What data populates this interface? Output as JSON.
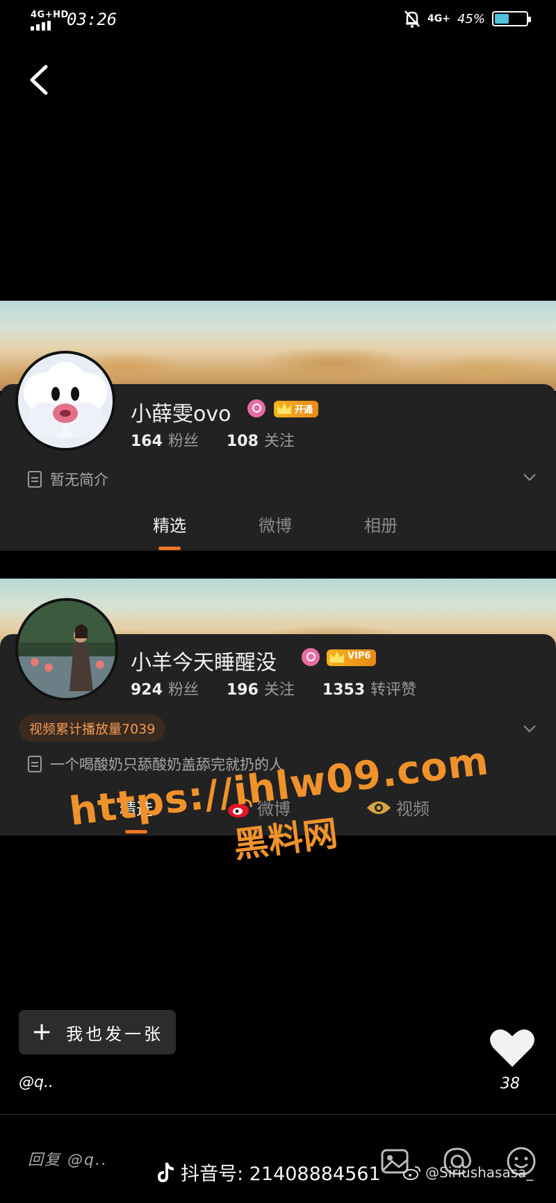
{
  "status": {
    "network": "4G+HD",
    "time": "03:26",
    "mobile_data": "4G+",
    "battery": "45%",
    "battery_level": 0.45
  },
  "profile1": {
    "name": "小薛雯ovo",
    "badge": "开通",
    "stats": [
      {
        "num": "164",
        "label": "粉丝"
      },
      {
        "num": "108",
        "label": "关注"
      }
    ],
    "intro": "暂无简介",
    "tabs": [
      "精选",
      "微博",
      "相册"
    ]
  },
  "profile2": {
    "name": "小羊今天睡醒没",
    "badge": "VIP6",
    "stats": [
      {
        "num": "924",
        "label": "粉丝"
      },
      {
        "num": "196",
        "label": "关注"
      },
      {
        "num": "1353",
        "label": "转评赞"
      }
    ],
    "video_plays": "视频累计播放量7039",
    "intro": "一个喝酸奶只舔酸奶盖舔完就扔的人",
    "tabs": [
      "精选",
      "微博",
      "视频"
    ]
  },
  "watermark": {
    "url": "https://ihlw09.com",
    "site": "黑料网"
  },
  "post_button": {
    "plus": "+",
    "label": "我也发一张"
  },
  "user_handle": "@q..",
  "likes": "38",
  "reply_placeholder": "回复 @q..",
  "douyin_id": "抖音号: 21408884561",
  "weibo_handle": "@Siriushasasa_",
  "colors": {
    "accent": "#f07522",
    "panel": "#222222",
    "watermark": "#f0922b"
  }
}
